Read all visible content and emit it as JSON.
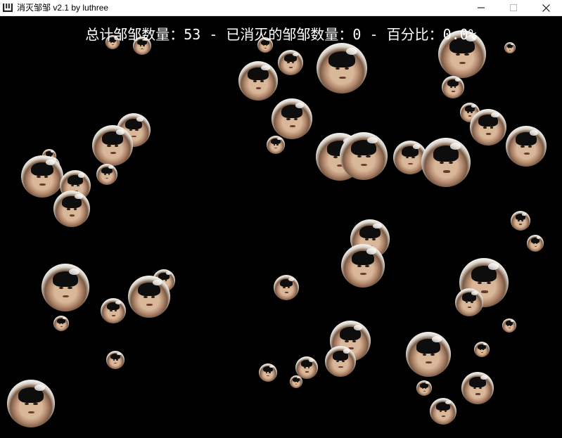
{
  "window": {
    "title": "消灭邹邹 v2.1 by luthree",
    "icon": "app-logo-icon",
    "buttons": [
      "minimize-icon",
      "maximize-icon",
      "close-icon"
    ]
  },
  "score": {
    "total_label": "总计邹邹数量：",
    "total": 53,
    "destroyed_label": "已消灭的邹邹数量：",
    "destroyed": 0,
    "percent_label": "百分比：",
    "percent": "0.0%",
    "separator": " - ",
    "text": "总计邹邹数量：53 - 已消灭的邹邹数量：0 - 百分比：0.0%"
  },
  "bubble_sprite": "face-bubble-icon",
  "colors": {
    "background": "#000000",
    "text": "#ffffff"
  }
}
